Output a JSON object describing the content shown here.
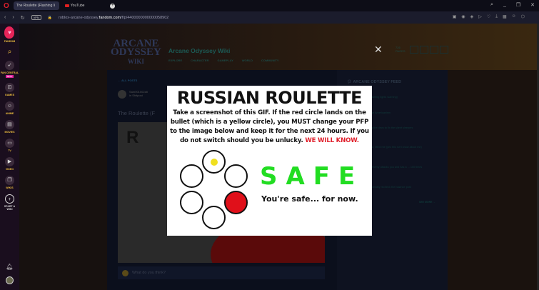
{
  "browser": {
    "tabs": [
      {
        "label": "The Roulette (Flashing li"
      },
      {
        "label": "YouTube"
      }
    ],
    "url_prefix": "roblox-arcane-odyssey.",
    "url_domain": "fandom.com",
    "url_path": "/f/p/4400000000000058902",
    "vpn": "VPN"
  },
  "sidebar": {
    "items": [
      {
        "label": "FANDOM",
        "icon": "fandom-flame-icon"
      },
      {
        "label": "",
        "icon": "search-icon"
      },
      {
        "label": "FAN CENTRAL",
        "icon": "rocket-icon",
        "badge": "BETA"
      },
      {
        "label": "GAMES",
        "icon": "gamepad-icon"
      },
      {
        "label": "ANIME",
        "icon": "anime-icon"
      },
      {
        "label": "MOVIES",
        "icon": "movie-icon"
      },
      {
        "label": "TV",
        "icon": "tv-icon"
      },
      {
        "label": "VIDEO",
        "icon": "video-icon"
      },
      {
        "label": "WIKIS",
        "icon": "book-icon"
      },
      {
        "label": "START A WIKI",
        "icon": "plus-icon"
      }
    ]
  },
  "wiki": {
    "logo": "ARCANE ODYSSEY WIKI",
    "title": "Arcane Odyssey Wiki",
    "nav": [
      "EXPLORE",
      "CHARACTER",
      "GAMEPLAY",
      "WORLD",
      "COMMUNITY"
    ],
    "pages": "726 PAGES"
  },
  "post": {
    "back": "← ALL POSTS",
    "user": "Sam001002alt",
    "category": "in Shitpost",
    "title": "The Roulette (F",
    "comment_placeholder": "What do you think?"
  },
  "feed": {
    "title": "ARCANE ODYSSEY FEED",
    "items": [
      "(flashing lights warning)",
      "...sh Americanism",
      "...g the devs to fix the silent sleepers",
      "...ld, Mind me (yes this isn't know about me)",
      "...enemy attacks you and has a ... 100 times",
      "...robably recheck the balance post"
    ],
    "see_more": "SEE MORE →"
  },
  "modal": {
    "title": "RUSSIAN ROULETTE",
    "body": "Take a screenshot of this GIF. If the red circle lands on the bullet (which is a yellow circle), you MUST change your PFP to the image below and keep it for the next 24 hours. If you do not switch should you be unlucky.",
    "warning": "WE WILL KNOW.",
    "result": "SAFE",
    "result_sub": "You're safe... for now.",
    "colors": {
      "safe": "#22dd22",
      "red": "#e0202c",
      "bullet": "#f0e020"
    }
  }
}
